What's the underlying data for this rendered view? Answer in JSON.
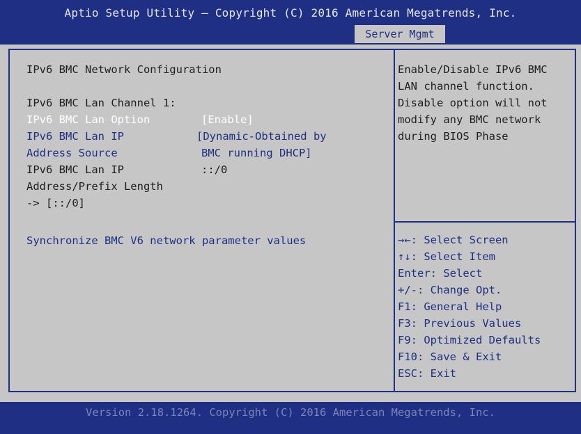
{
  "header": {
    "title": "Aptio Setup Utility – Copyright (C) 2016 American Megatrends, Inc.",
    "active_tab": "Server Mgmt"
  },
  "main": {
    "section_title": "IPv6 BMC Network Configuration",
    "channel_label": "IPv6 BMC Lan Channel 1:",
    "lan_option": {
      "label": "IPv6 BMC Lan Option",
      "value": "[Enable]"
    },
    "lan_ip_source": {
      "label_line1": "IPv6 BMC Lan IP",
      "label_line2": "Address Source",
      "value_line1": "[Dynamic-Obtained by",
      "value_line2": "BMC running DHCP]"
    },
    "lan_ip_address": {
      "label_line1": "IPv6 BMC Lan IP",
      "label_line2": "Address/Prefix Length",
      "label_line3": "-> [::/0]",
      "value": "::/0"
    },
    "sync_link": "Synchronize BMC V6 network parameter values"
  },
  "help": {
    "lines": [
      "Enable/Disable IPv6 BMC",
      "LAN channel function.",
      "Disable option will not",
      "modify any BMC network",
      "during BIOS Phase"
    ]
  },
  "keys": {
    "items": [
      "→←: Select Screen",
      "↑↓: Select Item",
      "Enter: Select",
      "+/-: Change Opt.",
      "F1: General Help",
      "F3: Previous Values",
      "F9: Optimized Defaults",
      "F10: Save & Exit",
      "ESC: Exit"
    ]
  },
  "footer": {
    "text": "Version 2.18.1264. Copyright (C) 2016 American Megatrends, Inc."
  }
}
